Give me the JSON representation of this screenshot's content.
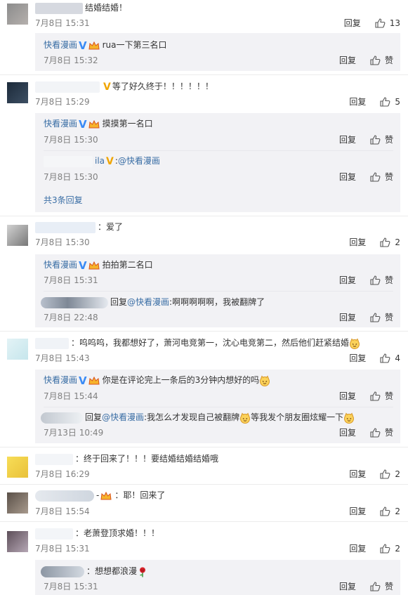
{
  "ui": {
    "reply_label": "回复",
    "like_label": "赞",
    "reply_prefix": "回复",
    "accent": "#3a6ea5"
  },
  "comments": [
    {
      "text": "结婚结婚！",
      "time": "7月8日 15:31",
      "likes": "13",
      "subs": [
        {
          "user": "快看漫画",
          "text": "rua一下第三名口",
          "time": "7月8日 15:32",
          "likes": "赞"
        }
      ]
    },
    {
      "text": "等了好久终于！！！！！！",
      "time": "7月8日 15:29",
      "likes": "5",
      "subs": [
        {
          "user": "快看漫画",
          "text": "摸摸第一名口",
          "time": "7月8日 15:30",
          "likes": "赞"
        },
        {
          "user_suffix": "ila",
          "mention": "@快看漫画",
          "time": "7月8日 15:30",
          "likes": "赞"
        }
      ],
      "more": "共3条回复"
    },
    {
      "text": "爱了",
      "time": "7月8日 15:30",
      "likes": "2",
      "subs": [
        {
          "user": "快看漫画",
          "text": "拍拍第二名口",
          "time": "7月8日 15:31",
          "likes": "赞"
        },
        {
          "mention": "@快看漫画",
          "text": ":啊啊啊啊啊，我被翻牌了",
          "time": "7月8日 22:48",
          "likes": "赞"
        }
      ]
    },
    {
      "text": "呜呜呜，我都想好了，萧河电竞第一，沈心电竞第二，然后他们赶紧结婚",
      "time": "7月8日 15:43",
      "likes": "4",
      "subs": [
        {
          "user": "快看漫画",
          "text": "你是在评论完上一条后的3分钟内想好的吗",
          "time": "7月8日 15:44",
          "likes": "赞"
        },
        {
          "mention": "@快看漫画",
          "text": ":我怎么才发现自己被翻牌",
          "text2": "等我发个朋友圈炫耀一下",
          "time": "7月13日 10:49",
          "likes": "赞"
        }
      ]
    },
    {
      "text": "终于回来了！！！要结婚结婚结婚哦",
      "time": "7月8日 16:29",
      "likes": "2"
    },
    {
      "text": "耶！回来了",
      "time": "7月8日 15:54",
      "likes": "2"
    },
    {
      "text": "老萧登顶求婚！！！",
      "time": "7月8日 15:31",
      "likes": "2",
      "subs": [
        {
          "text": "想想都浪漫",
          "time": "7月8日 15:31",
          "likes": "赞"
        }
      ]
    }
  ]
}
